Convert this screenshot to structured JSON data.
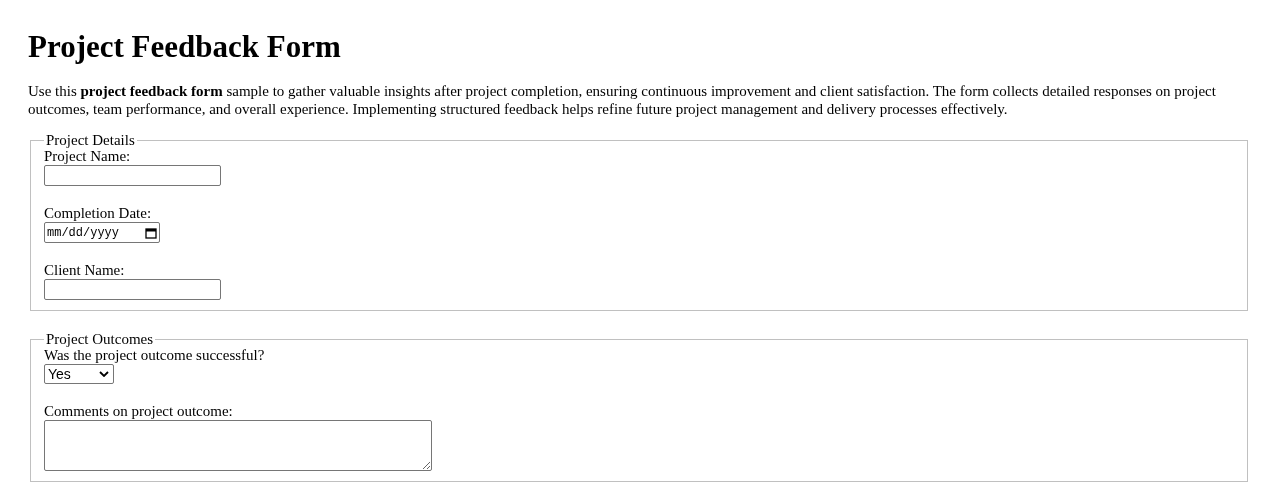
{
  "title": "Project Feedback Form",
  "intro": "Use this **project feedback form** sample to gather valuable insights after project completion, ensuring continuous improvement and client satisfaction. The form collects detailed responses on project outcomes, team performance, and overall experience. Implementing structured feedback helps refine future project management and delivery processes effectively.",
  "sections": [
    {
      "legend": "Project Details",
      "fields": [
        {
          "kind": "text",
          "label": "Project Name:"
        },
        {
          "kind": "date",
          "label": "Completion Date:",
          "placeholder": "mm/dd/yyyy"
        },
        {
          "kind": "text",
          "label": "Client Name:"
        }
      ]
    },
    {
      "legend": "Project Outcomes",
      "fields": [
        {
          "kind": "select",
          "label": "Was the project outcome successful?",
          "value": "Yes"
        },
        {
          "kind": "textarea",
          "label": "Comments on project outcome:"
        }
      ]
    }
  ]
}
